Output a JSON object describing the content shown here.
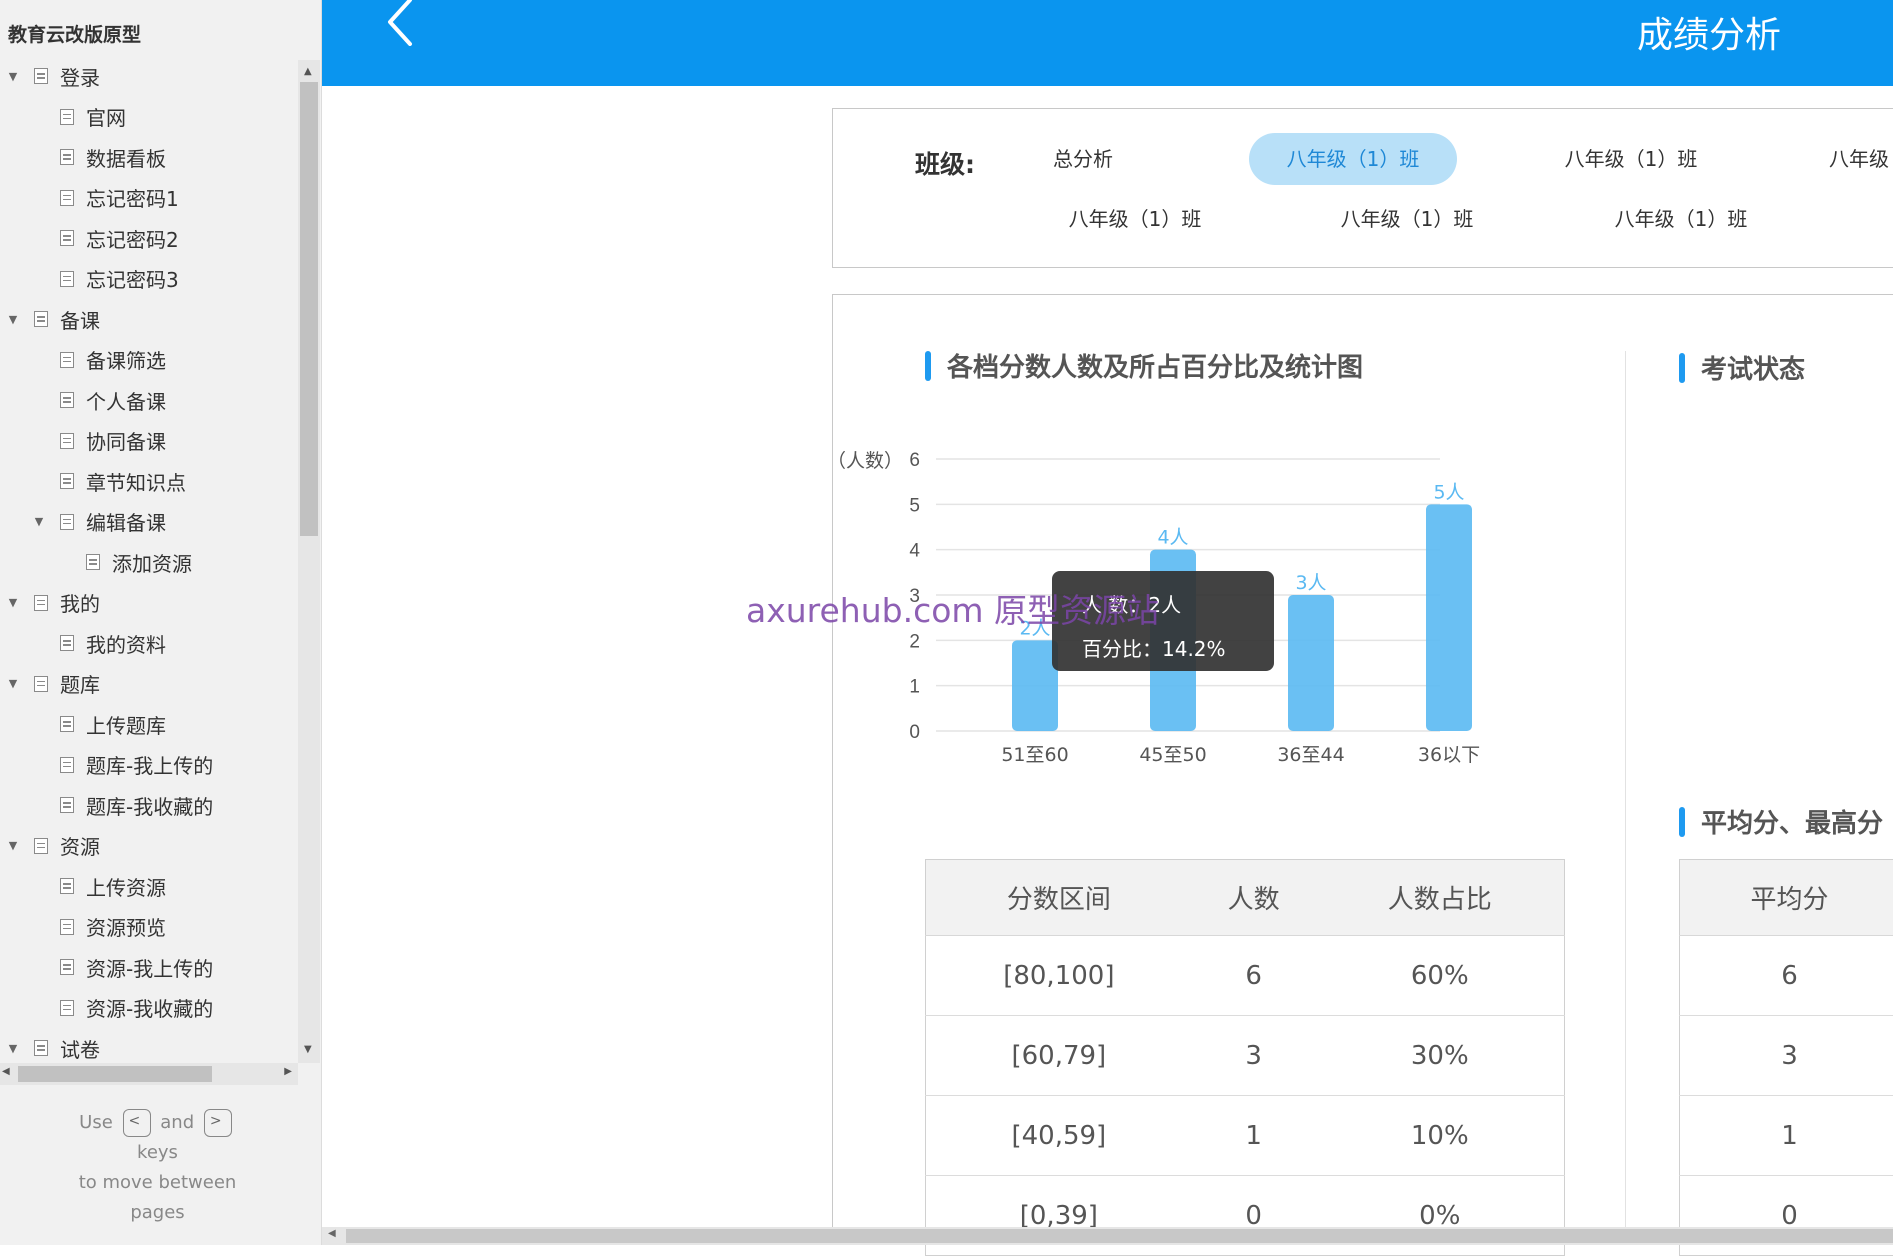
{
  "sidebar": {
    "project_title": "教育云改版原型",
    "tree": [
      {
        "label": "登录",
        "level": 0,
        "expanded": true
      },
      {
        "label": "官网",
        "level": 1
      },
      {
        "label": "数据看板",
        "level": 1
      },
      {
        "label": "忘记密码1",
        "level": 1
      },
      {
        "label": "忘记密码2",
        "level": 1
      },
      {
        "label": "忘记密码3",
        "level": 1
      },
      {
        "label": "备课",
        "level": 0,
        "expanded": true
      },
      {
        "label": "备课筛选",
        "level": 1
      },
      {
        "label": "个人备课",
        "level": 1
      },
      {
        "label": "协同备课",
        "level": 1
      },
      {
        "label": "章节知识点",
        "level": 1
      },
      {
        "label": "编辑备课",
        "level": 1,
        "expanded": true
      },
      {
        "label": "添加资源",
        "level": 2
      },
      {
        "label": "我的",
        "level": 0,
        "expanded": true
      },
      {
        "label": "我的资料",
        "level": 1
      },
      {
        "label": "题库",
        "level": 0,
        "expanded": true
      },
      {
        "label": "上传题库",
        "level": 1
      },
      {
        "label": "题库-我上传的",
        "level": 1
      },
      {
        "label": "题库-我收藏的",
        "level": 1
      },
      {
        "label": "资源",
        "level": 0,
        "expanded": true
      },
      {
        "label": "上传资源",
        "level": 1
      },
      {
        "label": "资源预览",
        "level": 1
      },
      {
        "label": "资源-我上传的",
        "level": 1
      },
      {
        "label": "资源-我收藏的",
        "level": 1
      },
      {
        "label": "试卷",
        "level": 0,
        "expanded": true
      }
    ],
    "key_hint": {
      "use": "Use",
      "and": "and",
      "keys": "keys",
      "line3": "to move between",
      "line4": "pages",
      "prev_key": "<",
      "next_key": ">"
    }
  },
  "header": {
    "title": "成绩分析",
    "background_color": "#0a95ef"
  },
  "class_filter": {
    "label": "班级:",
    "chips": [
      {
        "text": "总分析",
        "active": false
      },
      {
        "text": "八年级（1）班",
        "active": true
      },
      {
        "text": "八年级（1）班",
        "active": false
      },
      {
        "text": "八年级",
        "active": false
      },
      {
        "text": "八年级（1）班",
        "active": false
      },
      {
        "text": "八年级（1）班",
        "active": false
      },
      {
        "text": "八年级（1）班",
        "active": false
      }
    ]
  },
  "score_section": {
    "title": "各档分数人数及所占百分比及统计图",
    "tooltip": {
      "line1": "人    数：2人",
      "line2": "百分比：14.2%"
    },
    "table": {
      "headers": [
        "分数区间",
        "人数",
        "人数占比"
      ],
      "rows": [
        [
          "[80,100]",
          "6",
          "60%"
        ],
        [
          "[60,79]",
          "3",
          "30%"
        ],
        [
          "[40,59]",
          "1",
          "10%"
        ],
        [
          "[0,39]",
          "0",
          "0%"
        ]
      ]
    }
  },
  "chart_data": {
    "type": "bar",
    "categories": [
      "51至60",
      "45至50",
      "36至44",
      "36以下"
    ],
    "values": [
      2,
      4,
      3,
      5
    ],
    "data_labels": [
      "2人",
      "4人",
      "3人",
      "5人"
    ],
    "ylabel": "（人数）",
    "ylim": [
      0,
      6
    ],
    "yticks": [
      0,
      1,
      2,
      3,
      4,
      5,
      6
    ],
    "grid": true,
    "bar_color": "#5ab9f2",
    "label_color": "#5ab9f2"
  },
  "exam_status_section": {
    "title": "考试状态"
  },
  "average_section": {
    "title": "平均分、最高分",
    "table": {
      "headers": [
        "平均分"
      ],
      "rows": [
        [
          "6"
        ],
        [
          "3"
        ],
        [
          "1"
        ],
        [
          "0"
        ]
      ]
    }
  },
  "watermark": "axurehub.com 原型资源站"
}
